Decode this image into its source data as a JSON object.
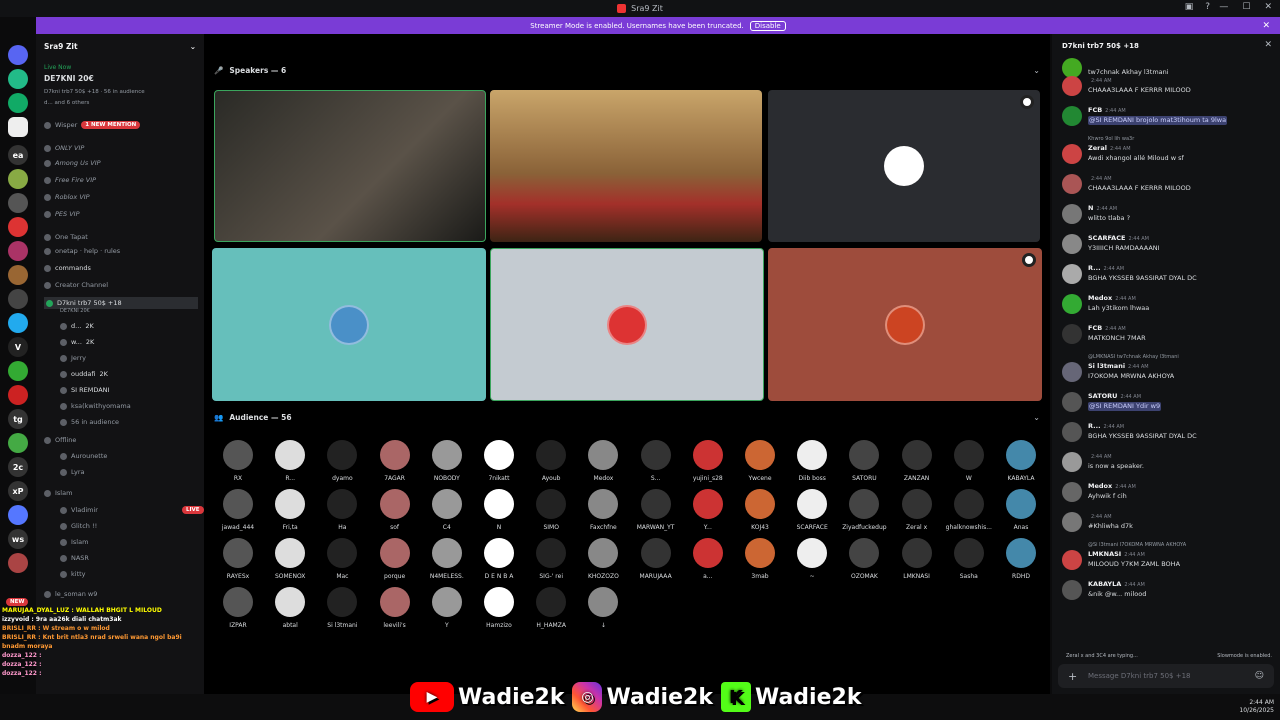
{
  "window": {
    "title": "Sra9 Zit"
  },
  "banner": {
    "text": "Streamer Mode is enabled. Usernames have been truncated.",
    "button": "Disable"
  },
  "sidebar": {
    "server": "Sra9 Zit",
    "live_label": "Live Now",
    "live_title": "DE7KNI 20€",
    "live_sub": "D7kni trb7 50$ +18 · 56 in audience",
    "live_sub2": "d... and 6 others",
    "wisper": "Wisper",
    "mention_badge": "1 NEW MENTION",
    "items": [
      {
        "label": "ONLY VIP"
      },
      {
        "label": "Among Us VIP"
      },
      {
        "label": "Free Fire VIP"
      },
      {
        "label": "Roblox VIP"
      },
      {
        "label": "PES VIP"
      },
      {
        "label": "One Tapat"
      },
      {
        "label": "onetap · help · rules"
      },
      {
        "label": "commands"
      },
      {
        "label": "Creator Channel"
      },
      {
        "label": "D7kni trb7 50$ +18"
      },
      {
        "label": "DE7KNI 20€"
      }
    ],
    "stage_users": [
      "d...",
      "w...",
      "Jerry",
      "ouddafi",
      "SI REMDANI",
      "ksa(kwithyomama",
      "56 in audience"
    ],
    "user_badge": "2K",
    "offline": "Offline",
    "offline_users": [
      "Aurounette",
      "Lyra"
    ],
    "islam": "Islam",
    "islam_badge": "LIVE",
    "islam_users": [
      "Vladimir",
      "Glitch !!",
      "Islam",
      "NASR",
      "kitty"
    ],
    "le_soman": "le_soman w9",
    "new_badge": "NEW"
  },
  "overlay_chat": [
    "MARUJAA_DYAL_LUZ : WALLAH BHGIT L MILOUD",
    "izzyvoid : 9ra aa26k diali chatm3ak",
    "BRISLI_RR : W stream o w milod",
    "BRISLI_RR : Knt brit ntla3 nrad srweli wana ngol ba9i bnadm moraya",
    "dozza_122 :",
    "dozza_122 :",
    "dozza_122 :"
  ],
  "main": {
    "speakers": "Speakers — 6",
    "audience": "Audience — 56"
  },
  "audience": [
    "RX",
    "R...",
    "dyamo",
    "7AGAR",
    "NOBODY",
    "7nikatt",
    "Ayoub",
    "Medox",
    "S...",
    "yujini_s28",
    "Ywcene",
    "Diib boss",
    "SATORU",
    "ZANZAN",
    "W",
    "KABAYLA",
    "jawad_444",
    "Fri,ta",
    "Ha",
    "sof",
    "C4",
    "N",
    "SIMO",
    "Faxchfne",
    "MARWAN_YT",
    "Y...",
    "KOJ43",
    "SCARFACE",
    "Ziyadfuckedup",
    "Zeral x",
    "ghalknowshis...",
    "Anas",
    "RAYESx",
    "SOMENOX",
    "Mac",
    "porque",
    "N4MELESS.",
    "D E N B A",
    "SIG-' rei",
    "KHOZOZO",
    "MARUJAAA",
    "a...",
    "3mab",
    "~",
    "OZOMAK",
    "LMKNASI",
    "Sasha",
    "RDHD",
    "IZPAR",
    "abtal",
    "Si l3tmani",
    "leevili's",
    "Y",
    "Hamzizo",
    "H_HAMZA",
    "↓"
  ],
  "chat": {
    "title": "D7kni trb7 50$ +18",
    "messages": [
      {
        "name": "",
        "time": "",
        "text": "tw7chnak Akhay l3tmani"
      },
      {
        "name": "",
        "time": "2:44 AM",
        "text": "CHAAA3LAAA F KERRR MILOOD"
      },
      {
        "name": "FCB",
        "time": "2:44 AM",
        "text": "@SI REMDANI brojolo mat3tihoum ta 9lwa"
      },
      {
        "name": "Zeral",
        "time": "2:44 AM",
        "text": "Awdi xhangol allé Miloud w sf",
        "reply": "Khwro 9ol lih wa3r"
      },
      {
        "name": "",
        "time": "2:44 AM",
        "text": "CHAAA3LAAA F KERRR MILOOD"
      },
      {
        "name": "N",
        "time": "2:44 AM",
        "text": "wlitto tlaba ?"
      },
      {
        "name": "SCARFACE",
        "time": "2:44 AM",
        "text": "Y3IIIICH RAMDAAAANI"
      },
      {
        "name": "R...",
        "time": "2:44 AM",
        "text": "BGHA YKSSEB 9ASSIRAT DYAL DC"
      },
      {
        "name": "Medox",
        "time": "2:44 AM",
        "text": "Lah y3tikom lhwaa"
      },
      {
        "name": "FCB",
        "time": "2:44 AM",
        "text": "MATKONCH 7MAR"
      },
      {
        "name": "Si l3tmani",
        "time": "2:44 AM",
        "text": "I7OKOMA MRWNA AKHOYA",
        "reply": "@LMKNASI tw7chnak Akhay l3tmani"
      },
      {
        "name": "SATORU",
        "time": "2:44 AM",
        "text": "@SI REMDANI Ydir w9"
      },
      {
        "name": "R...",
        "time": "2:44 AM",
        "text": "BGHA YKSSEB 9ASSIRAT DYAL DC"
      },
      {
        "name": "",
        "time": "2:44 AM",
        "text": "is now a speaker."
      },
      {
        "name": "Medox",
        "time": "2:44 AM",
        "text": "Ayhwik f cih"
      },
      {
        "name": "",
        "time": "2:44 AM",
        "text": "#Khliwha d7k"
      },
      {
        "name": "LMKNASI",
        "time": "2:44 AM",
        "text": "MILOOUD Y7KM ZAML BOHA",
        "reply": "@Si l3tmani I7OKOMA MRWNA AKHOYA"
      },
      {
        "name": "KABAYLA",
        "time": "2:44 AM",
        "text": "&nik @w... milood"
      }
    ],
    "typing": "Zeral x and 3C4 are typing...",
    "slowmode": "Slowmode is enabled.",
    "placeholder": "Message D7kni trb7 50$ +18"
  },
  "social": [
    "Wadie2k",
    "Wadie2k",
    "Wadie2k"
  ],
  "clock": {
    "time": "2:44 AM",
    "date": "10/26/2025"
  }
}
